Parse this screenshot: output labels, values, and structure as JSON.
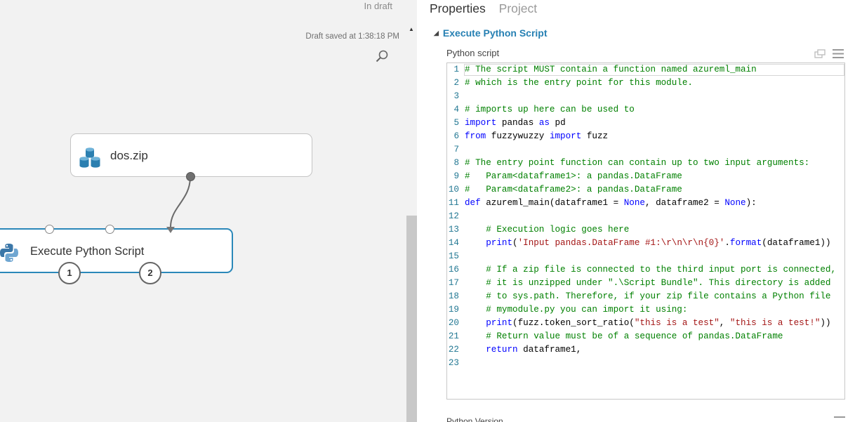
{
  "canvas": {
    "status": "In draft",
    "draft_saved": "Draft saved at 1:38:18 PM",
    "modules": {
      "dataset": {
        "label": "dos.zip",
        "icon": "dataset-icon"
      },
      "script": {
        "label": "Execute Python Script",
        "icon": "python-icon",
        "outputs": [
          "1",
          "2"
        ]
      }
    }
  },
  "panel": {
    "tabs": [
      "Properties",
      "Project"
    ],
    "active_tab": "Properties",
    "section_title": "Execute Python Script",
    "field_label": "Python script",
    "next_field_label": "Python Version"
  },
  "colors": {
    "accent": "#2680b3",
    "module_selected_border": "#2b88b9",
    "comment": "#008000",
    "keyword": "#0000ff",
    "string": "#a31515"
  },
  "code": {
    "line_numbers": [
      "1",
      "2",
      "3",
      "4",
      "5",
      "6",
      "7",
      "8",
      "9",
      "10",
      "11",
      "12",
      "13",
      "14",
      "15",
      "16",
      "17",
      "18",
      "19",
      "20",
      "21",
      "22",
      "23"
    ],
    "lines": [
      [
        {
          "t": "c",
          "v": "# The script MUST contain a function named azureml_main"
        }
      ],
      [
        {
          "t": "c",
          "v": "# which is the entry point for this module."
        }
      ],
      [],
      [
        {
          "t": "c",
          "v": "# imports up here can be used to"
        }
      ],
      [
        {
          "t": "k",
          "v": "import"
        },
        {
          "t": "n",
          "v": " pandas "
        },
        {
          "t": "k",
          "v": "as"
        },
        {
          "t": "n",
          "v": " pd"
        }
      ],
      [
        {
          "t": "k",
          "v": "from"
        },
        {
          "t": "n",
          "v": " fuzzywuzzy "
        },
        {
          "t": "k",
          "v": "import"
        },
        {
          "t": "n",
          "v": " fuzz"
        }
      ],
      [],
      [
        {
          "t": "c",
          "v": "# The entry point function can contain up to two input arguments:"
        }
      ],
      [
        {
          "t": "c",
          "v": "#   Param<dataframe1>: a pandas.DataFrame"
        }
      ],
      [
        {
          "t": "c",
          "v": "#   Param<dataframe2>: a pandas.DataFrame"
        }
      ],
      [
        {
          "t": "k",
          "v": "def"
        },
        {
          "t": "n",
          "v": " azureml_main(dataframe1 = "
        },
        {
          "t": "k",
          "v": "None"
        },
        {
          "t": "n",
          "v": ", dataframe2 = "
        },
        {
          "t": "k",
          "v": "None"
        },
        {
          "t": "n",
          "v": "):"
        }
      ],
      [],
      [
        {
          "t": "n",
          "v": "    "
        },
        {
          "t": "c",
          "v": "# Execution logic goes here"
        }
      ],
      [
        {
          "t": "n",
          "v": "    "
        },
        {
          "t": "k",
          "v": "print"
        },
        {
          "t": "n",
          "v": "("
        },
        {
          "t": "s",
          "v": "'Input pandas.DataFrame #1:\\r\\n\\r\\n{0}'"
        },
        {
          "t": "n",
          "v": "."
        },
        {
          "t": "k",
          "v": "format"
        },
        {
          "t": "n",
          "v": "(dataframe1))"
        }
      ],
      [],
      [
        {
          "t": "n",
          "v": "    "
        },
        {
          "t": "c",
          "v": "# If a zip file is connected to the third input port is connected,"
        }
      ],
      [
        {
          "t": "n",
          "v": "    "
        },
        {
          "t": "c",
          "v": "# it is unzipped under \".\\Script Bundle\". This directory is added"
        }
      ],
      [
        {
          "t": "n",
          "v": "    "
        },
        {
          "t": "c",
          "v": "# to sys.path. Therefore, if your zip file contains a Python file"
        }
      ],
      [
        {
          "t": "n",
          "v": "    "
        },
        {
          "t": "c",
          "v": "# mymodule.py you can import it using:"
        }
      ],
      [
        {
          "t": "n",
          "v": "    "
        },
        {
          "t": "k",
          "v": "print"
        },
        {
          "t": "n",
          "v": "(fuzz.token_sort_ratio("
        },
        {
          "t": "s",
          "v": "\"this is a test\""
        },
        {
          "t": "n",
          "v": ", "
        },
        {
          "t": "s",
          "v": "\"this is a test!\""
        },
        {
          "t": "n",
          "v": "))"
        }
      ],
      [
        {
          "t": "n",
          "v": "    "
        },
        {
          "t": "c",
          "v": "# Return value must be of a sequence of pandas.DataFrame"
        }
      ],
      [
        {
          "t": "n",
          "v": "    "
        },
        {
          "t": "k",
          "v": "return"
        },
        {
          "t": "n",
          "v": " dataframe1,"
        }
      ],
      []
    ]
  }
}
